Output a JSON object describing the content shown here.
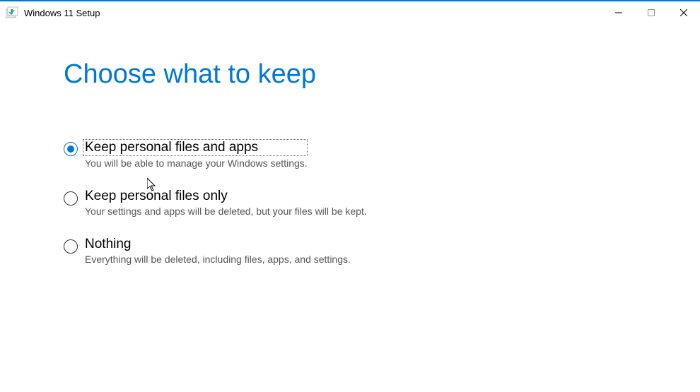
{
  "window": {
    "title": "Windows 11 Setup"
  },
  "page": {
    "heading": "Choose what to keep"
  },
  "options": [
    {
      "label": "Keep personal files and apps",
      "description": "You will be able to manage your Windows settings.",
      "selected": true
    },
    {
      "label": "Keep personal files only",
      "description": "Your settings and apps will be deleted, but your files will be kept.",
      "selected": false
    },
    {
      "label": "Nothing",
      "description": "Everything will be deleted, including files, apps, and settings.",
      "selected": false
    }
  ]
}
